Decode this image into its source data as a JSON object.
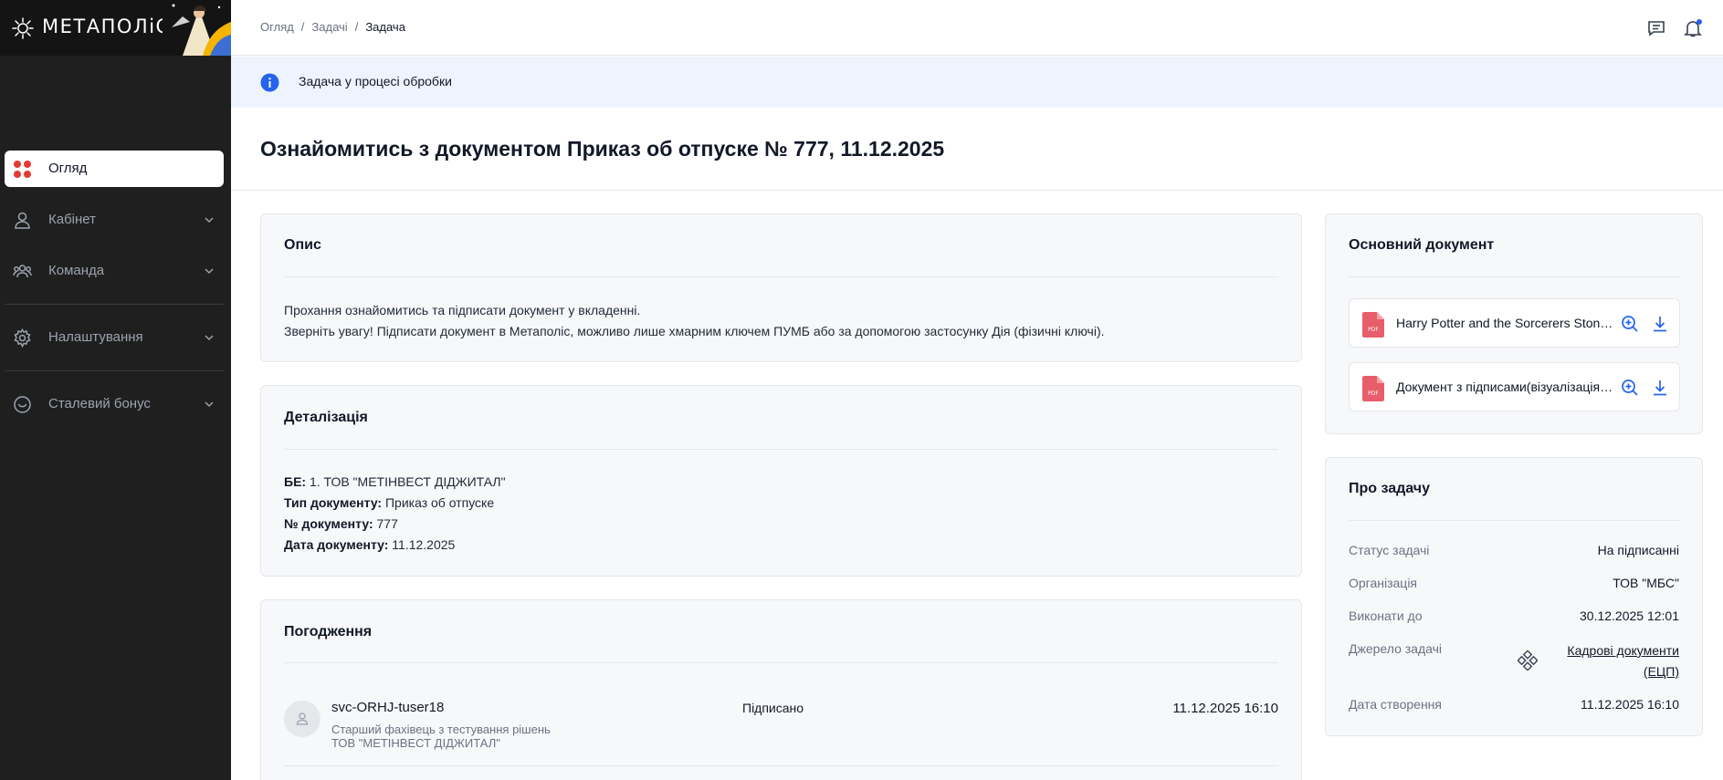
{
  "app": {
    "logo_text": "МЕТАПОЛіС"
  },
  "sidebar": {
    "items": [
      {
        "label": "Огляд",
        "icon": "grid-icon",
        "active": true
      },
      {
        "label": "Кабінет",
        "icon": "user-icon"
      },
      {
        "label": "Команда",
        "icon": "team-icon"
      },
      {
        "label": "Налаштування",
        "icon": "gear-icon"
      },
      {
        "label": "Сталевий бонус",
        "icon": "smile-icon"
      }
    ]
  },
  "header": {
    "breadcrumb": [
      "Огляд",
      "Задачі",
      "Задача"
    ],
    "separator": "/"
  },
  "banner": {
    "text": "Задача у процесі обробки"
  },
  "page": {
    "title": "Ознайомитись з документом Приказ об отпуске № 777, 11.12.2025"
  },
  "description": {
    "title": "Опис",
    "lines": [
      "Прохання ознайомитись та підписати документ у вкладенні.",
      "Зверніть увагу! Підписати документ в Метаполіс, можливо лише хмарним ключем ПУМБ або за допомогою застосунку Дія (фізичні ключі)."
    ]
  },
  "details": {
    "title": "Деталізація",
    "rows": [
      {
        "label": "БЕ:",
        "value": "1. ТОВ \"МЕТІНВЕСТ ДІДЖИТАЛ\""
      },
      {
        "label": "Тип документу:",
        "value": "Приказ об отпуске"
      },
      {
        "label": "№ документу:",
        "value": "777"
      },
      {
        "label": "Дата документу:",
        "value": "11.12.2025"
      }
    ]
  },
  "approvals": {
    "title": "Погодження",
    "rows": [
      {
        "name": "svc-ORHJ-tuser18",
        "position": "Старший фахівець з тестування рішень",
        "company": "ТОВ \"МЕТІНВЕСТ ДІДЖИТАЛ\"",
        "status": "Підписано",
        "date": "11.12.2025 16:10"
      }
    ]
  },
  "main_document": {
    "title": "Основний документ",
    "files": [
      {
        "name": "Harry Potter and the Sorcerers Stone.pdf",
        "type": "PDF"
      },
      {
        "name": "Документ з підписами(візуалізація).pdf",
        "type": "PDF"
      }
    ]
  },
  "about": {
    "title": "Про задачу",
    "status_label": "Статус задачі",
    "status_value": "На підписанні",
    "org_label": "Організація",
    "org_value": "ТОВ \"МБС\"",
    "due_label": "Виконати до",
    "due_value": "30.12.2025 12:01",
    "source_label": "Джерело задачі",
    "source_value_line1": "Кадрові документи",
    "source_value_line2": "(ЕЦП)",
    "created_label": "Дата створення",
    "created_value": "11.12.2025 16:10"
  },
  "colors": {
    "sidebar_bg": "#1f1f1f",
    "accent_red": "#e53935",
    "info_blue": "#2563eb",
    "banner_bg": "#eef4fe"
  }
}
